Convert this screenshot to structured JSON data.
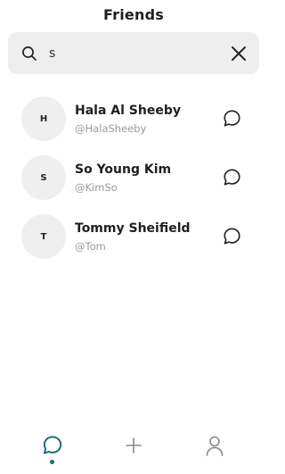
{
  "header": {
    "title": "Friends"
  },
  "search": {
    "value": "s"
  },
  "friends": [
    {
      "initial": "H",
      "name": "Hala Al Sheeby",
      "handle": "@HalaSheeby"
    },
    {
      "initial": "S",
      "name": "So Young Kim",
      "handle": "@KimSo"
    },
    {
      "initial": "T",
      "name": "Tommy Sheifield",
      "handle": "@Tom"
    }
  ],
  "tabbar": {
    "active_tab": "chats",
    "active_color": "#1e6e7a"
  },
  "icons": {
    "search": "search-icon",
    "clear": "close-icon",
    "chat": "chat-bubble-icon",
    "add": "plus-icon",
    "profile": "user-icon"
  }
}
